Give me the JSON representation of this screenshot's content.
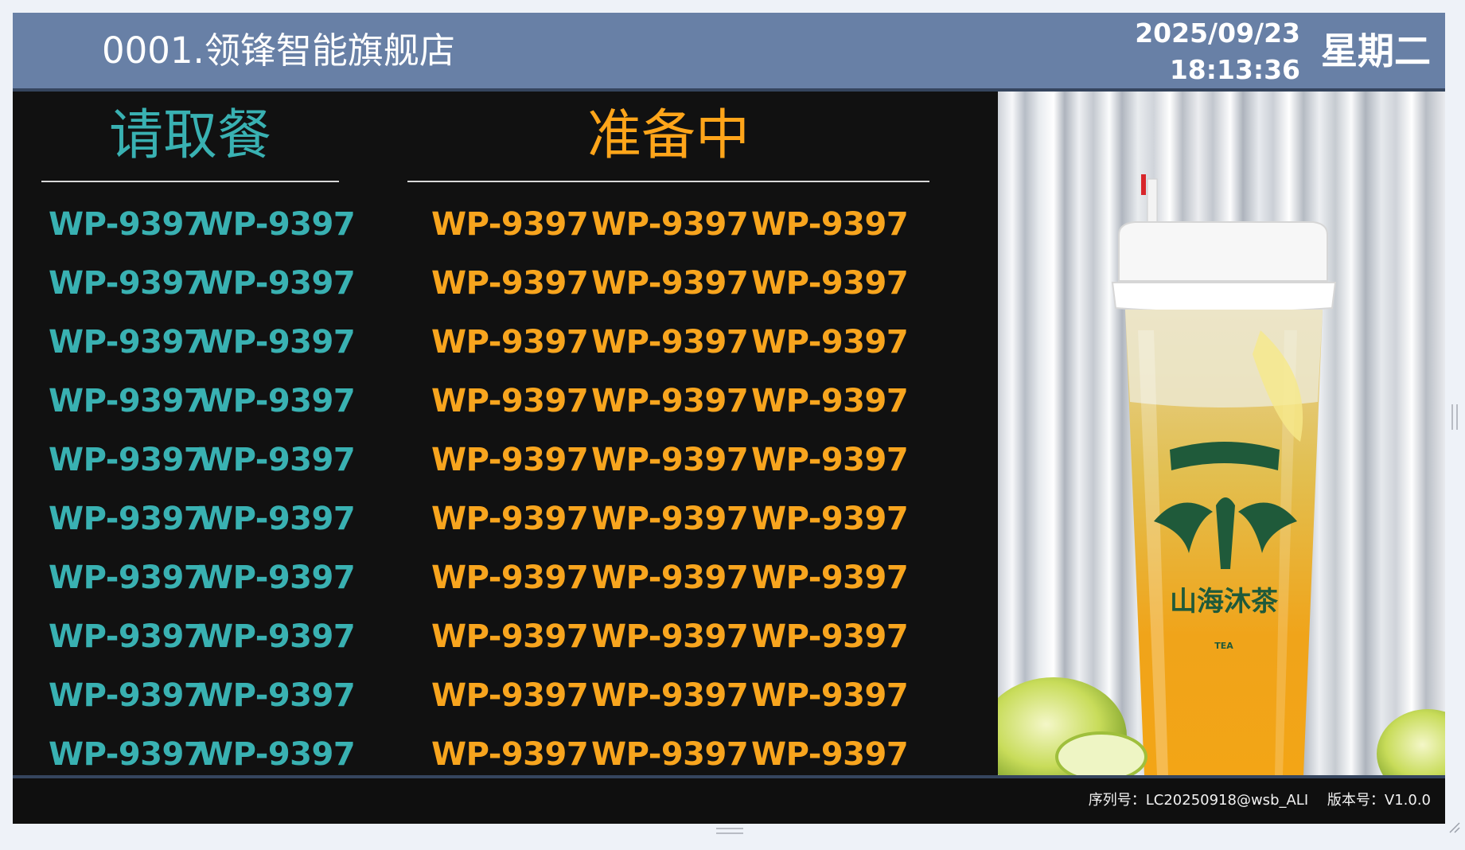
{
  "header": {
    "store_name": "0001.领锋智能旗舰店",
    "date": "2025/09/23",
    "time": "18:13:36",
    "weekday": "星期二"
  },
  "ready": {
    "title": "请取餐",
    "orders": [
      "WP-9397",
      "WP-9397",
      "WP-9397",
      "WP-9397",
      "WP-9397",
      "WP-9397",
      "WP-9397",
      "WP-9397",
      "WP-9397",
      "WP-9397",
      "WP-9397",
      "WP-9397",
      "WP-9397",
      "WP-9397",
      "WP-9397",
      "WP-9397",
      "WP-9397",
      "WP-9397",
      "WP-9397",
      "WP-9397"
    ]
  },
  "preparing": {
    "title": "准备中",
    "orders": [
      "WP-9397",
      "WP-9397",
      "WP-9397",
      "WP-9397",
      "WP-9397",
      "WP-9397",
      "WP-9397",
      "WP-9397",
      "WP-9397",
      "WP-9397",
      "WP-9397",
      "WP-9397",
      "WP-9397",
      "WP-9397",
      "WP-9397",
      "WP-9397",
      "WP-9397",
      "WP-9397",
      "WP-9397",
      "WP-9397",
      "WP-9397",
      "WP-9397",
      "WP-9397",
      "WP-9397",
      "WP-9397",
      "WP-9397",
      "WP-9397",
      "WP-9397",
      "WP-9397",
      "WP-9397"
    ]
  },
  "promo": {
    "brand_name": "山海沐茶",
    "brand_sub": "TEA"
  },
  "footer": {
    "serial": "序列号：LC20250918@wsb_ALI",
    "version": "版本号：V1.0.0"
  },
  "colors": {
    "header_bg": "#6880a6",
    "ready_text": "#39b1b2",
    "preparing_text": "#f8a51e",
    "board_bg": "#111111"
  },
  "icons": {
    "resize": "resize-grip-icon",
    "handle": "drag-handle-icon"
  }
}
